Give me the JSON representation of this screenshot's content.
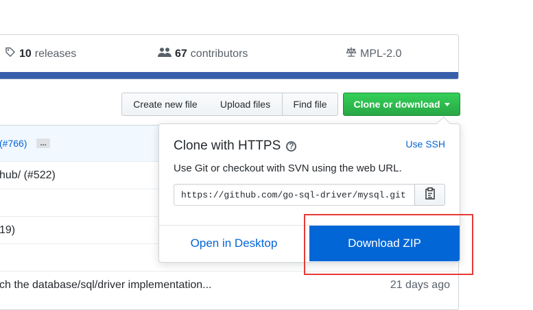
{
  "summary": {
    "releases_count": "10",
    "releases_label": "releases",
    "contributors_count": "67",
    "contributors_label": "contributors",
    "license": "MPL-2.0",
    "language_color": "#375eab"
  },
  "toolbar": {
    "create_new_file": "Create new file",
    "upload_files": "Upload files",
    "find_file": "Find file",
    "clone_or_download": "Clone or download"
  },
  "files": {
    "rows": [
      {
        "text": "(#766)",
        "age": ""
      },
      {
        "text": "hub/ (#522)",
        "age": ""
      },
      {
        "text": "",
        "age": ""
      },
      {
        "text": "19)",
        "age": ""
      },
      {
        "text": "",
        "age": ""
      },
      {
        "text": "ch the database/sql/driver implementation...",
        "age": "21 days ago"
      }
    ],
    "ellipsis": "..."
  },
  "clone_panel": {
    "title": "Clone with HTTPS",
    "help_glyph": "?",
    "use_ssh": "Use SSH",
    "description": "Use Git or checkout with SVN using the web URL.",
    "url": "https://github.com/go-sql-driver/mysql.git",
    "open_in_desktop": "Open in Desktop",
    "download_zip": "Download ZIP"
  },
  "colors": {
    "link": "#0366d6",
    "green": "#28a745",
    "highlight": "#e53935"
  },
  "icons": {
    "releases": "tag-icon",
    "contributors": "people-icon",
    "license": "law-icon",
    "copy": "clippy-icon"
  }
}
